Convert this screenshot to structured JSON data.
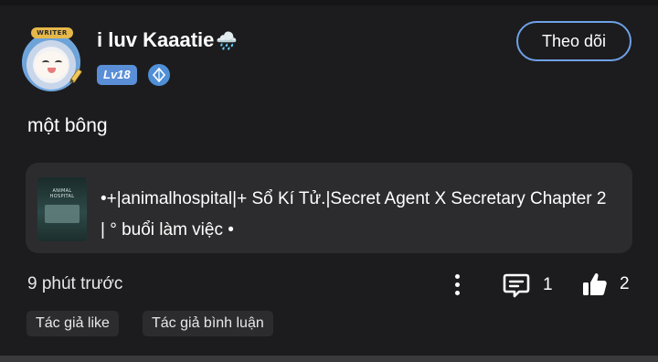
{
  "post": {
    "author": {
      "name": "i luv Kaaatie",
      "name_emoji": "🌧️",
      "avatar_badge": "WRITER",
      "level": "Lv18",
      "icons": {
        "avatar": "anime-avatar-icon",
        "gem": "diamond-icon",
        "pen": "pen-icon"
      }
    },
    "follow_label": "Theo dõi",
    "text": "một bông",
    "linked_story": {
      "cover_text": "ANIMAL HOSPITAL",
      "title": "•+|animalhospital|+ Sổ Kí Tử.|Secret Agent X Secretary Chapter 2 | ° buổi làm việc •"
    },
    "timestamp": "9 phút trước",
    "comment_count": "1",
    "like_count": "2",
    "tags": [
      "Tác giả like",
      "Tác giả bình luận"
    ]
  },
  "colors": {
    "background": "#1c1c1e",
    "card": "#2c2c2e",
    "accent": "#6ea0e6",
    "level_badge": "#5a8fd8"
  }
}
